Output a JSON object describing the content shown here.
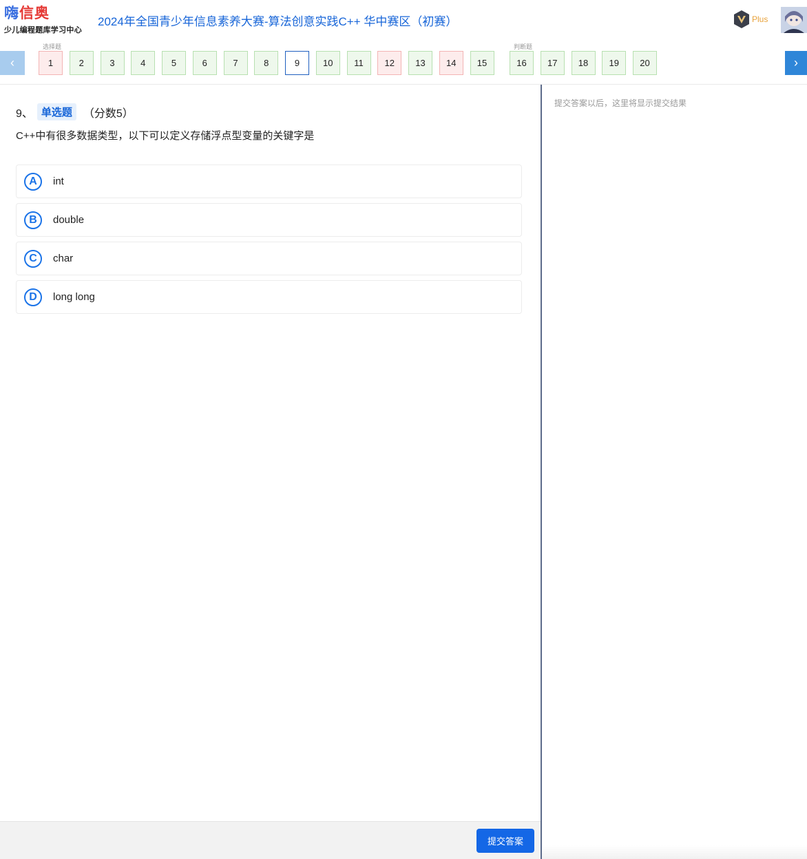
{
  "header": {
    "logo_part1": "嗨",
    "logo_part2": "信奥",
    "logo_sub": "少儿编程题库学习中心",
    "title": "2024年全国青少年信息素养大赛-算法创意实践C++ 华中赛区（初赛）",
    "plus_label": "Plus",
    "plus_icon": "vip-v-badge-icon",
    "avatar_icon": "user-avatar"
  },
  "nav": {
    "prev_icon": "chevron-left-icon",
    "next_icon": "chevron-right-icon",
    "group_choice_label": "选择题",
    "group_judge_label": "判断题",
    "questions": [
      "1",
      "2",
      "3",
      "4",
      "5",
      "6",
      "7",
      "8",
      "9",
      "10",
      "11",
      "12",
      "13",
      "14",
      "15",
      "16",
      "17",
      "18",
      "19",
      "20"
    ],
    "wrong": [
      "1",
      "12",
      "14"
    ],
    "current": "9",
    "colors": {
      "answered_bg": "#eef8ec",
      "wrong_bg": "#fdecec",
      "current_border": "#1f5fbf"
    }
  },
  "question": {
    "number": "9、",
    "type": "单选题",
    "score": "（分数5）",
    "text": "C++中有很多数据类型，以下可以定义存储浮点型变量的关键字是",
    "options": [
      {
        "letter": "A",
        "text": "int"
      },
      {
        "letter": "B",
        "text": "double"
      },
      {
        "letter": "C",
        "text": "char"
      },
      {
        "letter": "D",
        "text": "long long"
      }
    ]
  },
  "result_panel": {
    "hint": "提交答案以后，这里将显示提交结果"
  },
  "footer": {
    "submit_label": "提交答案",
    "accent": "#1467e6"
  }
}
